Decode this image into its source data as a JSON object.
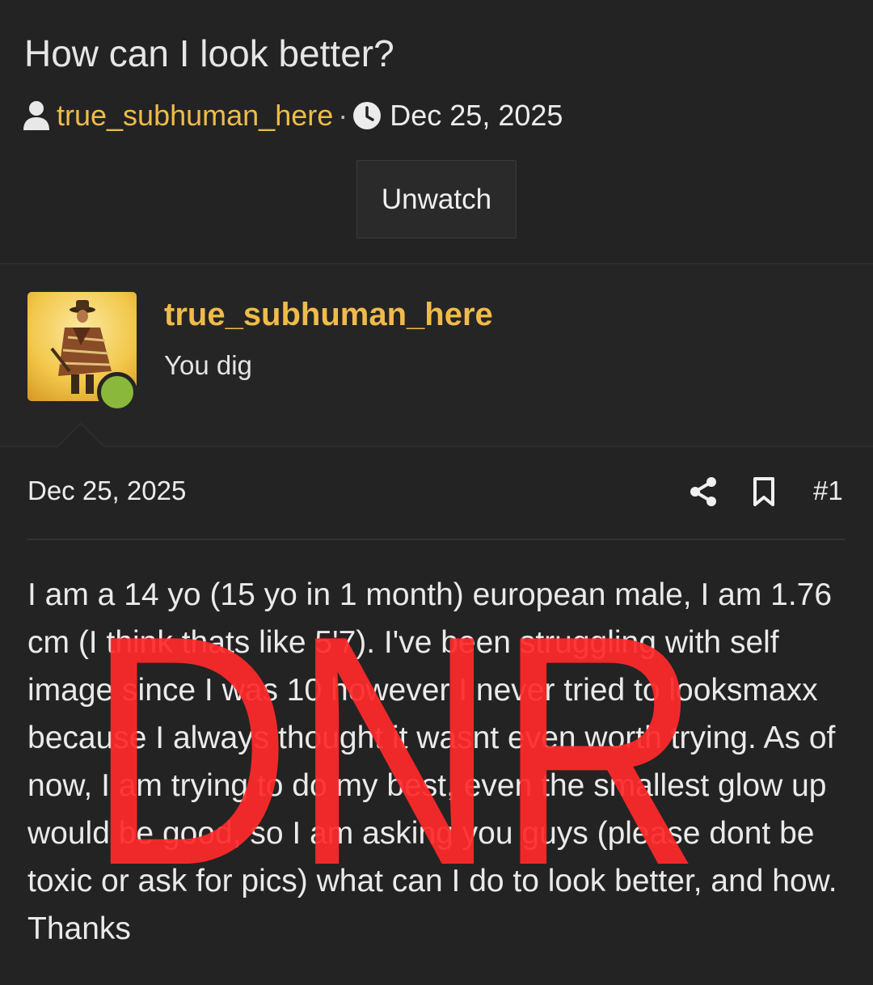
{
  "thread": {
    "title": "How can I look better?",
    "author": "true_subhuman_here",
    "separator": "·",
    "date": "Dec 25, 2025",
    "unwatch_label": "Unwatch"
  },
  "post": {
    "username": "true_subhuman_here",
    "user_title": "You dig",
    "online": true,
    "date": "Dec 25, 2025",
    "number": "#1",
    "body": "I am a 14 yo (15 yo in 1 month) european male, I am 1.76 cm (I think thats like 5'7). I've been struggling with self image since I was 10 however I never tried to looksmaxx because I always thought it wasnt even worth trying. As of now, I am trying to do my best, even the smallest glow up would be good, so I am asking you guys (please dont be toxic or ask for pics) what can I do to look better, and how. Thanks"
  },
  "watermark": {
    "text": "DNR",
    "color": "#ff2a2a"
  },
  "icons": [
    "user-icon",
    "clock-icon",
    "share-icon",
    "bookmark-icon"
  ],
  "colors": {
    "background": "#232323",
    "accent_username": "#efbb4a",
    "online": "#8ab83b"
  }
}
